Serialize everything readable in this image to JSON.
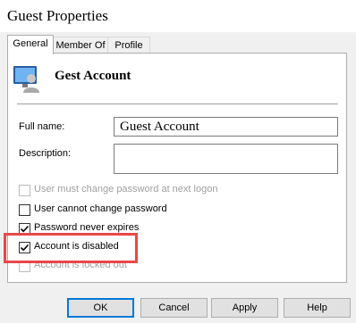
{
  "window": {
    "title": "Guest Properties"
  },
  "tabs": [
    {
      "label": "General",
      "active": true
    },
    {
      "label": "Member Of",
      "active": false
    },
    {
      "label": "Profile",
      "active": false
    }
  ],
  "user": {
    "display_name": "Gest Account",
    "icon": "user-account-icon"
  },
  "fields": {
    "full_name_label": "Full name:",
    "full_name_value": "Guest Account",
    "description_label": "Description:",
    "description_value": ""
  },
  "options": [
    {
      "label": "User must change password at next logon",
      "checked": false,
      "enabled": false
    },
    {
      "label": "User cannot change password",
      "checked": false,
      "enabled": true
    },
    {
      "label": "Password never expires",
      "checked": true,
      "enabled": true
    },
    {
      "label": "Account is disabled",
      "checked": true,
      "enabled": true
    },
    {
      "label": "Account is locked out",
      "checked": false,
      "enabled": false
    }
  ],
  "buttons": {
    "ok": "OK",
    "cancel": "Cancel",
    "apply": "Apply",
    "help": "Help"
  },
  "colors": {
    "highlight": "#e8474b",
    "default_button_border": "#0078d7"
  }
}
